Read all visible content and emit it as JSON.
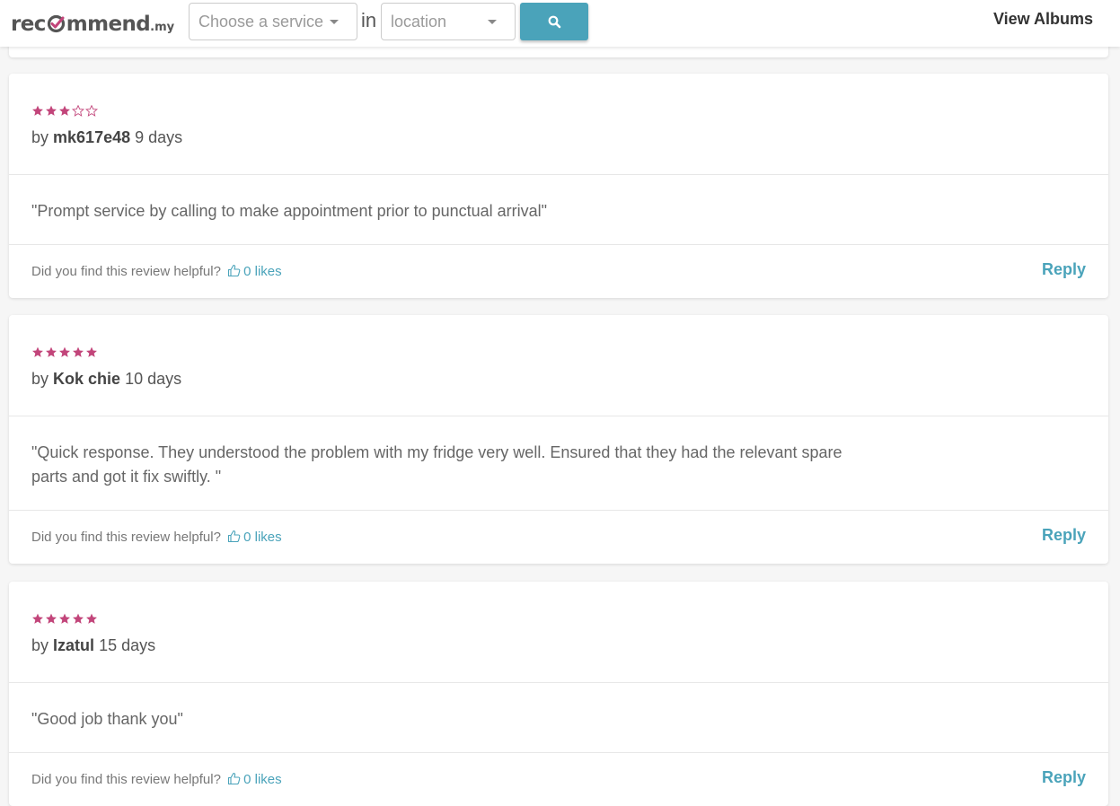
{
  "header": {
    "logo_main": "rec",
    "logo_rest": "mmend",
    "logo_tld": ".my",
    "service_placeholder": "Choose a service",
    "in_label": "in",
    "location_placeholder": "location",
    "view_albums": "View Albums"
  },
  "colors": {
    "accent": "#4aa3ba",
    "star": "#c2457a",
    "logo_check": "#c2457a"
  },
  "reviews": [
    {
      "rating": 3,
      "by_prefix": "by",
      "author": "mk617e48",
      "age": "9 days",
      "text": "\"Prompt service by calling to make appointment prior to punctual arrival\"",
      "helpful_question": "Did you find this review helpful?",
      "likes": "0 likes",
      "reply_label": "Reply"
    },
    {
      "rating": 5,
      "by_prefix": "by",
      "author": "Kok chie",
      "age": "10 days",
      "text": "\"Quick response. They understood the problem with my fridge very well. Ensured that they had the relevant spare parts and got it fix swiftly. \"",
      "helpful_question": "Did you find this review helpful?",
      "likes": "0 likes",
      "reply_label": "Reply"
    },
    {
      "rating": 5,
      "by_prefix": "by",
      "author": "Izatul",
      "age": "15 days",
      "text": "\"Good job thank you\"",
      "helpful_question": "Did you find this review helpful?",
      "likes": "0 likes",
      "reply_label": "Reply"
    }
  ]
}
